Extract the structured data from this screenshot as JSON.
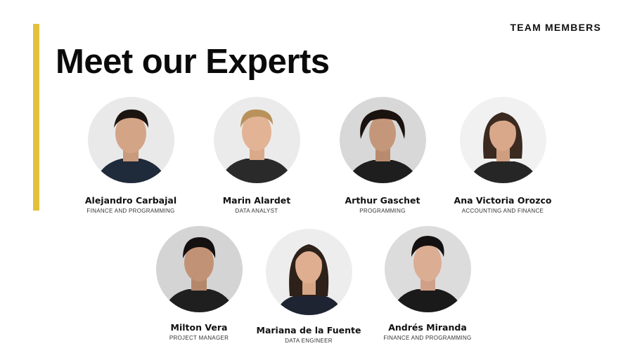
{
  "header": {
    "section_label": "TEAM MEMBERS",
    "title": "Meet our Experts"
  },
  "colors": {
    "accent": "#e2c13e",
    "text": "#111111",
    "background": "#ffffff"
  },
  "team": [
    {
      "name": "Alejandro Carbajal",
      "role": "FINANCE AND PROGRAMMING"
    },
    {
      "name": "Marin Alardet",
      "role": "DATA ANALYST"
    },
    {
      "name": "Arthur Gaschet",
      "role": "PROGRAMMING"
    },
    {
      "name": "Ana Victoria Orozco",
      "role": "ACCOUNTING AND FINANCE"
    },
    {
      "name": "Milton Vera",
      "role": "PROJECT MANAGER"
    },
    {
      "name": "Mariana de la Fuente",
      "role": "DATA ENGINEER"
    },
    {
      "name": "Andrés Miranda",
      "role": "FINANCE AND PROGRAMMING"
    }
  ]
}
